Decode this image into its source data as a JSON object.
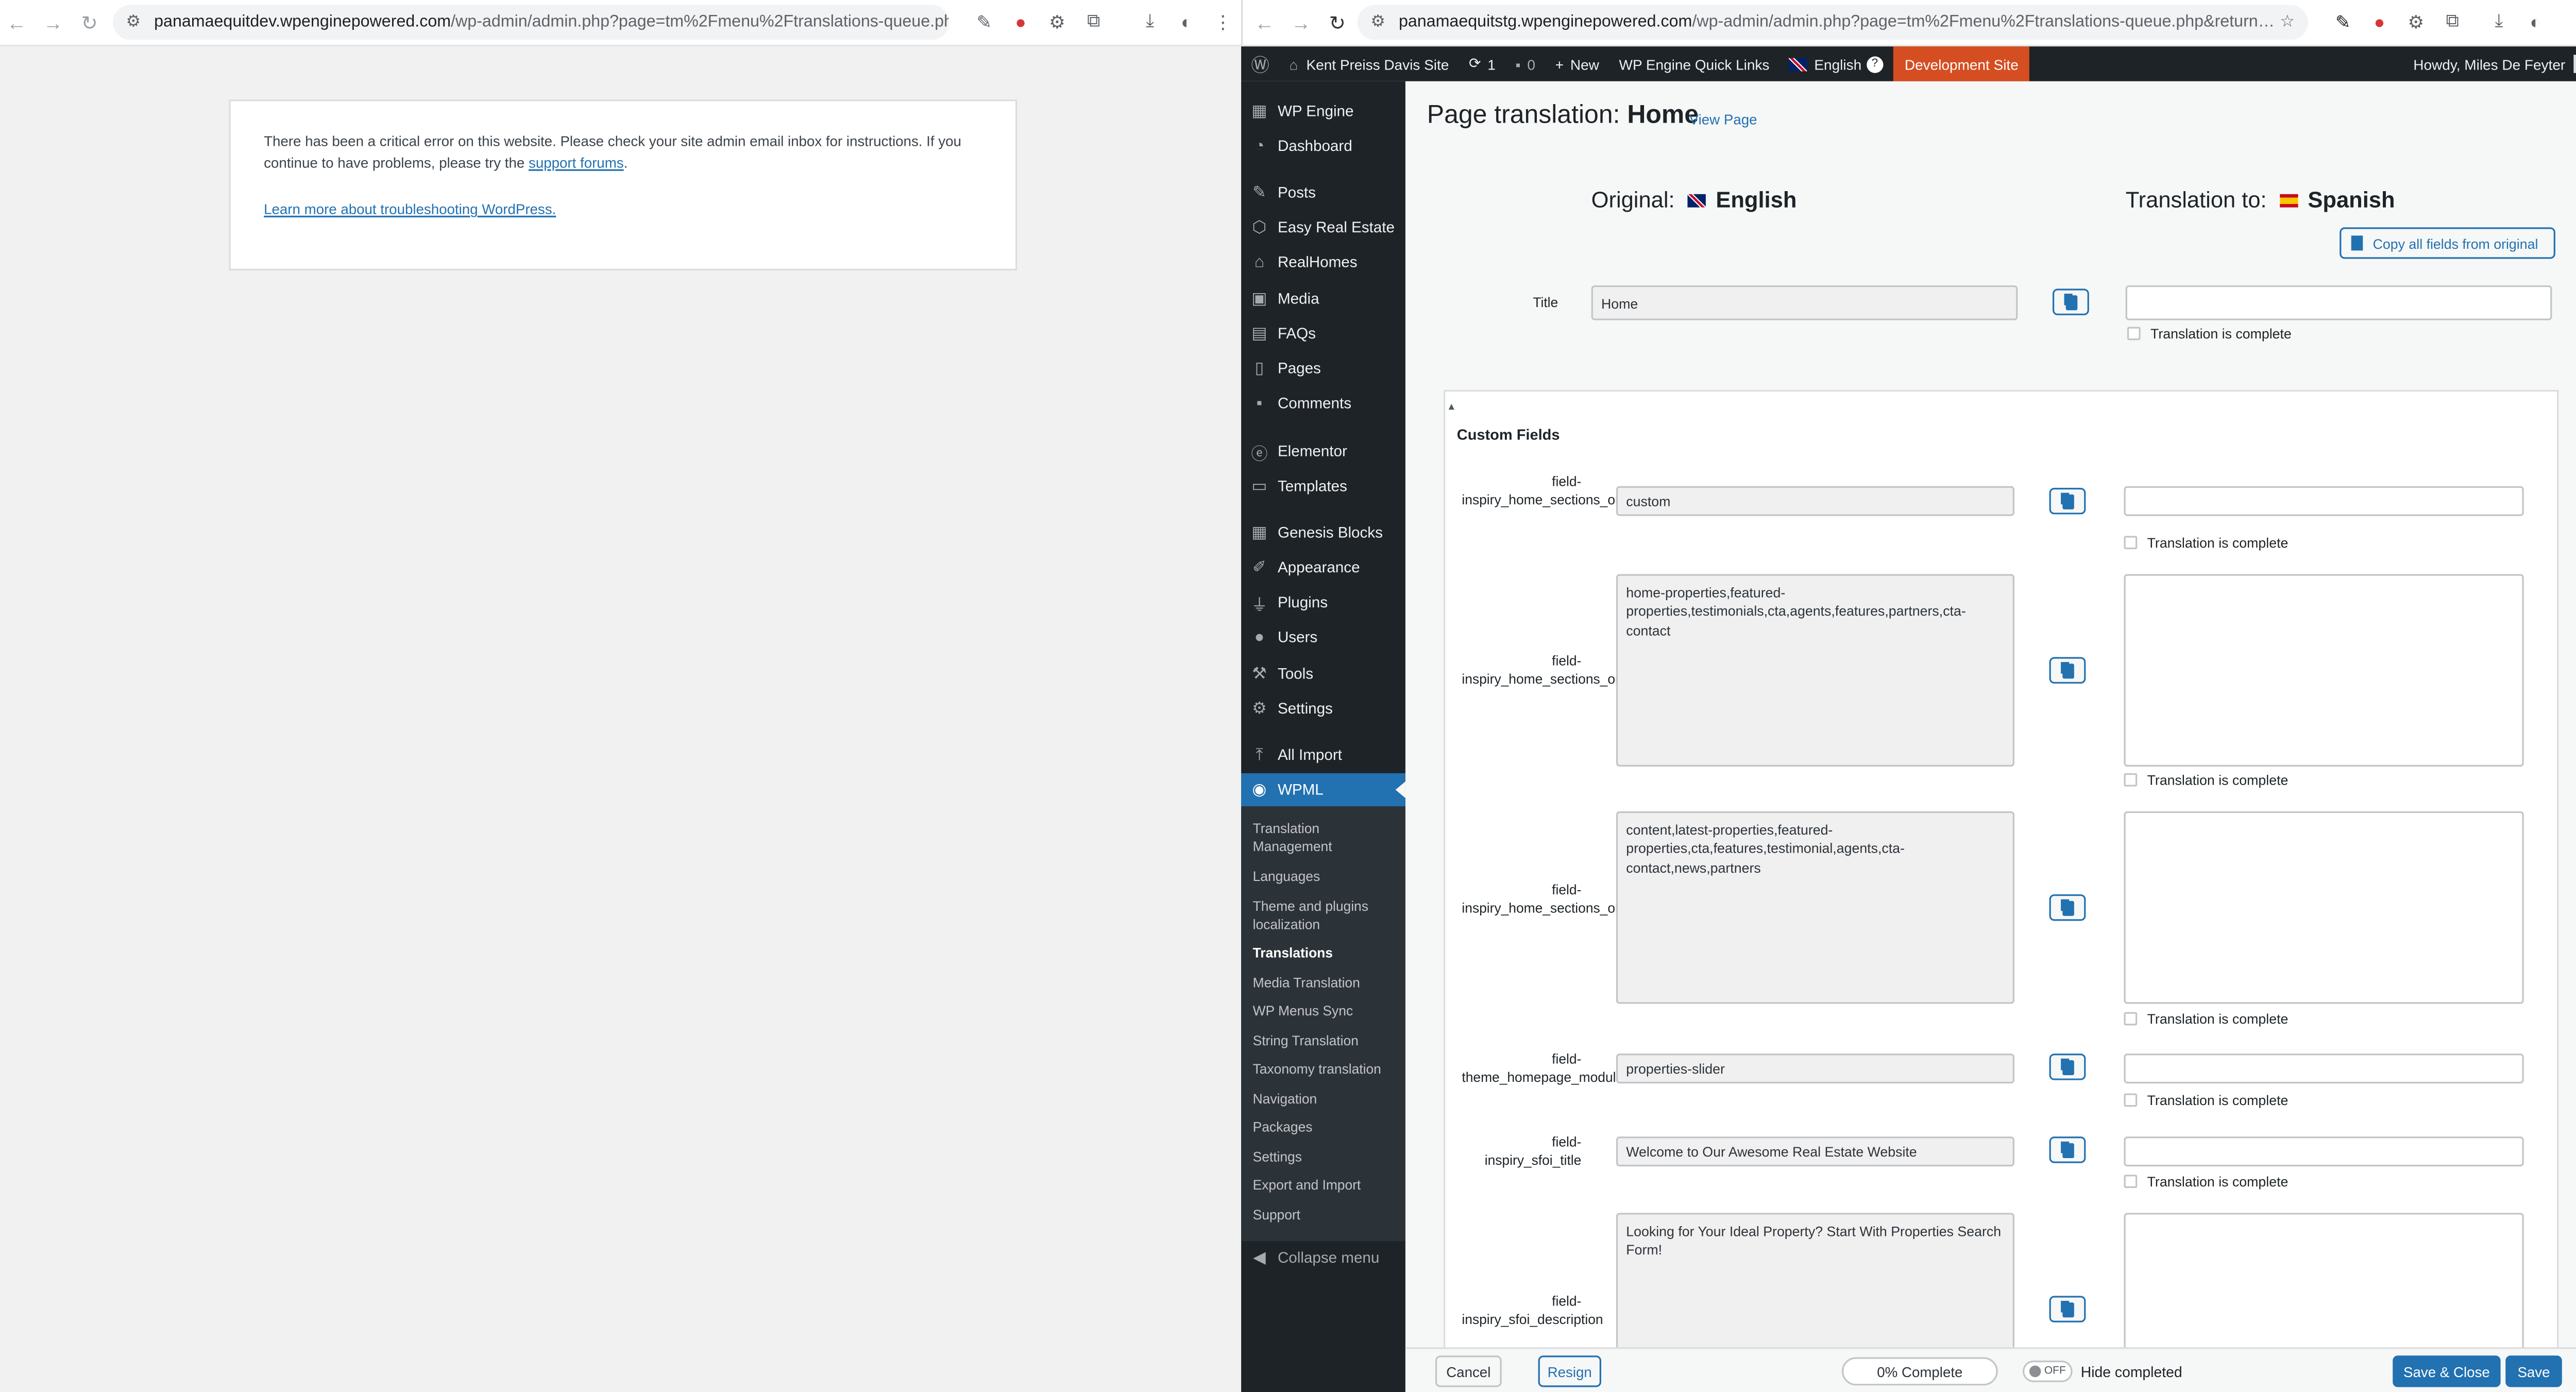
{
  "left_browser": {
    "url_host": "panamaequitdev.wpenginepowered.com",
    "url_path": "/wp-admin/admin.php?page=tm%2Fmenu%2Ftranslations-queue.ph...",
    "error_text": "There has been a critical error on this website. Please check your site admin email inbox for instructions. If you continue to have problems, please try the",
    "error_link": "support forums",
    "error_end": ".",
    "learn_more": "Learn more about troubleshooting WordPress."
  },
  "right_browser": {
    "url_host": "panamaequitstg.wpenginepowered.com",
    "url_path": "/wp-admin/admin.php?page=tm%2Fmenu%2Ftranslations-queue.php&return_url=%2...",
    "ext_badge": "OFF"
  },
  "admin_bar": {
    "site_name": "Kent Preiss Davis Site",
    "updates": "1",
    "comments": "0",
    "new": "New",
    "quick_links": "WP Engine Quick Links",
    "language": "English",
    "help": "?",
    "dev_site": "Development Site",
    "howdy": "Howdy, Miles De Feyter"
  },
  "sidebar": {
    "items": [
      "WP Engine",
      "Dashboard",
      "Posts",
      "Easy Real Estate",
      "RealHomes",
      "Media",
      "FAQs",
      "Pages",
      "Comments",
      "Elementor",
      "Templates",
      "Genesis Blocks",
      "Appearance",
      "Plugins",
      "Users",
      "Tools",
      "Settings",
      "All Import",
      "WPML"
    ],
    "sub_items": [
      "Translation Management",
      "Languages",
      "Theme and plugins localization",
      "Translations",
      "Media Translation",
      "WP Menus Sync",
      "String Translation",
      "Taxonomy translation",
      "Navigation",
      "Packages",
      "Settings",
      "Export and Import",
      "Support"
    ],
    "collapse": "Collapse menu"
  },
  "editor": {
    "title_prefix": "Page translation:",
    "title_name": "Home",
    "view_page": "View Page",
    "original_label": "Original:",
    "original_lang": "English",
    "translation_label": "Translation to:",
    "translation_lang": "Spanish",
    "copy_all": "Copy all fields from original",
    "title_field_label": "Title",
    "title_value": "Home",
    "complete_label": "Translation is complete",
    "section_toggle": "▴",
    "section_title": "Custom Fields",
    "fields": [
      {
        "label": "field-inspiry_home_sections_order_default",
        "value": "custom"
      },
      {
        "label": "field-inspiry_home_sections_order",
        "value": "home-properties,featured-properties,testimonials,cta,agents,features,partners,cta-contact"
      },
      {
        "label": "field-inspiry_home_sections_order_mod",
        "value": "content,latest-properties,featured-properties,cta,features,testimonial,agents,cta-contact,news,partners"
      },
      {
        "label": "field-theme_homepage_module",
        "value": "properties-slider"
      },
      {
        "label": "field-inspiry_sfoi_title",
        "value": "Welcome to Our Awesome Real Estate Website"
      },
      {
        "label": "field-inspiry_sfoi_description",
        "value": "Looking for Your Ideal Property? Start With Properties Search Form!"
      }
    ]
  },
  "footer": {
    "cancel": "Cancel",
    "resign": "Resign",
    "progress": "0% Complete",
    "toggle": "OFF",
    "hide_completed": "Hide completed",
    "save_close": "Save & Close",
    "save": "Save"
  },
  "colors": {
    "wp_blue": "#2271b1",
    "admin_dark": "#1d2327",
    "dev_orange": "#d63638"
  }
}
